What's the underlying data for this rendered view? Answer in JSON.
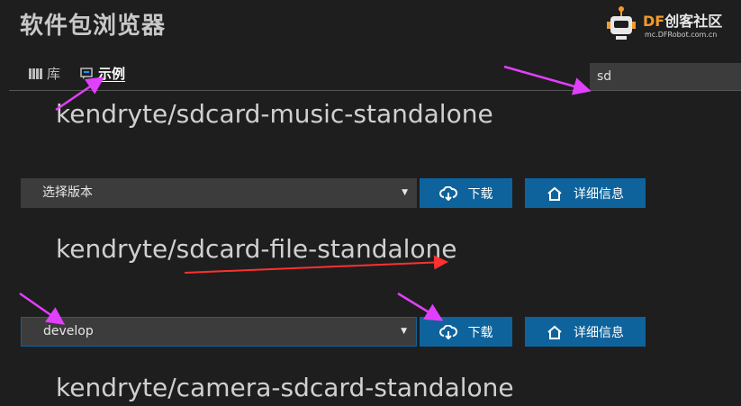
{
  "header": {
    "title": "软件包浏览器",
    "logo": {
      "brand_prefix": "DF",
      "brand_suffix": "创客社区",
      "url": "mc.DFRobot.com.cn"
    }
  },
  "tabs": [
    {
      "label": "库",
      "icon": "library-icon",
      "active": false
    },
    {
      "label": "示例",
      "icon": "examples-icon",
      "active": true
    }
  ],
  "search": {
    "value": "sd"
  },
  "packages": [
    {
      "name": "kendryte/sdcard-music-standalone",
      "version": "选择版本",
      "download_label": "下载",
      "info_label": "详细信息"
    },
    {
      "name": "kendryte/sdcard-file-standalone",
      "version": "develop",
      "download_label": "下载",
      "info_label": "详细信息"
    },
    {
      "name": "kendryte/camera-sdcard-standalone"
    }
  ],
  "colors": {
    "background": "#1e1e1e",
    "button": "#0e639c",
    "annotation_arrow": "#e040fb",
    "annotation_arrow_red": "#ff3030"
  }
}
